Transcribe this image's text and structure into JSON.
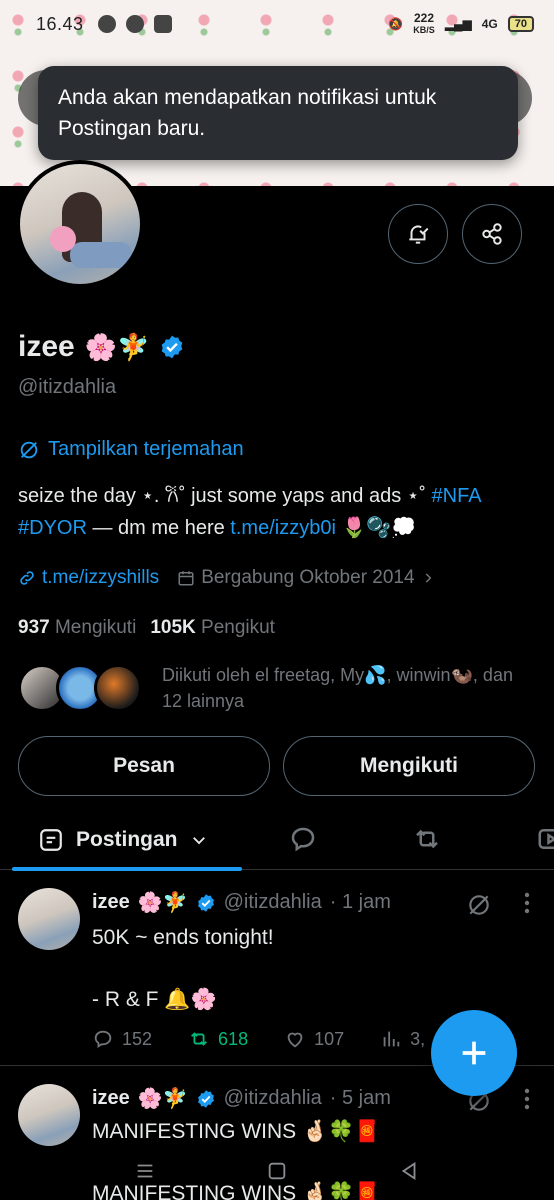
{
  "status_bar": {
    "time": "16.43",
    "net_speed_value": "222",
    "net_speed_unit": "KB/S",
    "network": "4G",
    "battery": "70"
  },
  "toast": {
    "message": "Anda akan mendapatkan notifikasi untuk Postingan baru."
  },
  "profile": {
    "name": "izee",
    "name_emojis": "🌸🧚",
    "handle": "@itizdahlia",
    "translate_label": "Tampilkan terjemahan",
    "bio_text": "seize the day ⋆. 𐙚˚ just some yaps and ads ⋆˚ ",
    "bio_tag_nfa": "#NFA",
    "bio_tag_dyor": "#DYOR",
    "bio_middle": " — dm me here ",
    "bio_link": "t.me/izzyb0i",
    "bio_end": " 🌷🫧💭",
    "website": "t.me/izzyshills",
    "joined": "Bergabung Oktober 2014",
    "following_count": "937",
    "following_label": "Mengikuti",
    "followers_count": "105K",
    "followers_label": "Pengikut",
    "followed_by": "Diikuti oleh el freetag, My💦, winwin🦦, dan 12 lainnya"
  },
  "buttons": {
    "message": "Pesan",
    "following": "Mengikuti"
  },
  "tabs": {
    "posts": "Postingan"
  },
  "tweets": [
    {
      "name": "izee",
      "emojis": "🌸🧚",
      "handle": "@itizdahlia",
      "time": "· 1 jam",
      "body": "50K ~ ends tonight!\n\n- R & F 🔔🌸",
      "replies": "152",
      "reposts": "618",
      "likes": "107",
      "views": "3,"
    },
    {
      "name": "izee",
      "emojis": "🌸🧚",
      "handle": "@itizdahlia",
      "time": "· 5 jam",
      "body": "MANIFESTING WINS 🤞🏻🍀🧧\n\nMANIFESTING WINS 🤞🏻🍀🧧"
    }
  ],
  "colors": {
    "accent": "#1d9bf0",
    "repost_green": "#00ba7c",
    "muted": "#71767b"
  }
}
